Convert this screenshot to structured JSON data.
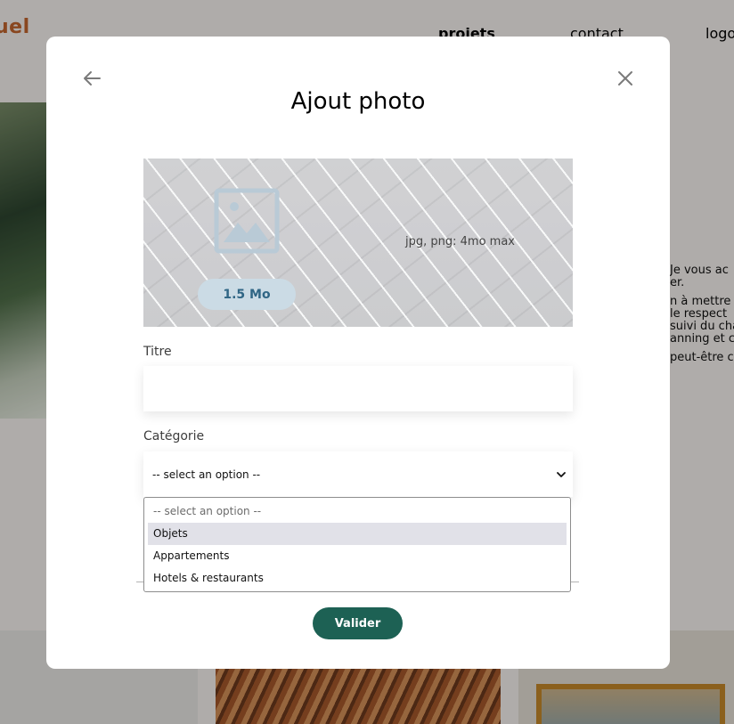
{
  "background": {
    "brand": "uel",
    "nav": {
      "projets": "projets",
      "contact": "contact",
      "logout": "logo"
    },
    "bio_lines": [
      "Je vous ac",
      "er.",
      "n à mettre",
      "le respect",
      "suivi du cha",
      "anning et c",
      "peut-être c"
    ]
  },
  "modal": {
    "title": "Ajout photo",
    "back_icon": "arrow-left-icon",
    "close_icon": "close-icon",
    "upload": {
      "image_icon": "image-placeholder-icon",
      "size_label": "1.5 Mo",
      "format_hint": "jpg, png: 4mo max"
    },
    "title_field": {
      "label": "Titre",
      "value": "",
      "placeholder": ""
    },
    "category_field": {
      "label": "Catégorie",
      "selected": "-- select an option --",
      "chevron_icon": "chevron-down-icon",
      "options": [
        {
          "label": "-- select an option --",
          "state": "placeholder"
        },
        {
          "label": "Objets",
          "state": "highlighted"
        },
        {
          "label": "Appartements",
          "state": "normal"
        },
        {
          "label": "Hotels & restaurants",
          "state": "normal"
        }
      ]
    },
    "submit_label": "Valider"
  },
  "colors": {
    "brand": "#c4662f",
    "accent": "#1d6154",
    "upload_bg": "#e8f1f6",
    "pill_bg": "#cbdbe5",
    "pill_text": "#306685",
    "highlight": "#e1e1e8"
  }
}
